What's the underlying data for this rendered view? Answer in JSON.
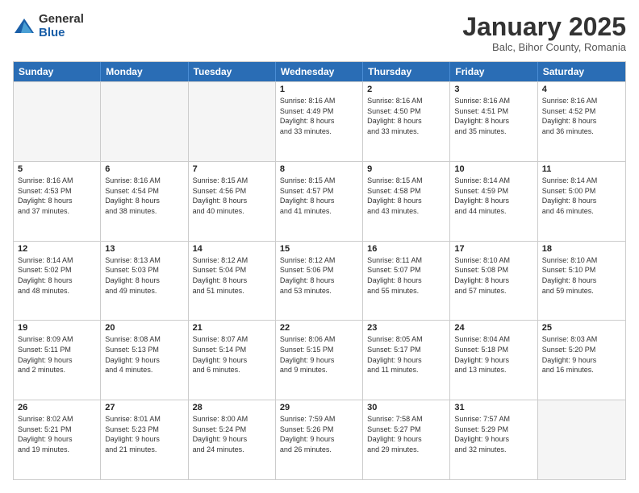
{
  "logo": {
    "general": "General",
    "blue": "Blue"
  },
  "header": {
    "month": "January 2025",
    "location": "Balc, Bihor County, Romania"
  },
  "weekdays": [
    "Sunday",
    "Monday",
    "Tuesday",
    "Wednesday",
    "Thursday",
    "Friday",
    "Saturday"
  ],
  "rows": [
    [
      {
        "day": "",
        "lines": []
      },
      {
        "day": "",
        "lines": []
      },
      {
        "day": "",
        "lines": []
      },
      {
        "day": "1",
        "lines": [
          "Sunrise: 8:16 AM",
          "Sunset: 4:49 PM",
          "Daylight: 8 hours",
          "and 33 minutes."
        ]
      },
      {
        "day": "2",
        "lines": [
          "Sunrise: 8:16 AM",
          "Sunset: 4:50 PM",
          "Daylight: 8 hours",
          "and 33 minutes."
        ]
      },
      {
        "day": "3",
        "lines": [
          "Sunrise: 8:16 AM",
          "Sunset: 4:51 PM",
          "Daylight: 8 hours",
          "and 35 minutes."
        ]
      },
      {
        "day": "4",
        "lines": [
          "Sunrise: 8:16 AM",
          "Sunset: 4:52 PM",
          "Daylight: 8 hours",
          "and 36 minutes."
        ]
      }
    ],
    [
      {
        "day": "5",
        "lines": [
          "Sunrise: 8:16 AM",
          "Sunset: 4:53 PM",
          "Daylight: 8 hours",
          "and 37 minutes."
        ]
      },
      {
        "day": "6",
        "lines": [
          "Sunrise: 8:16 AM",
          "Sunset: 4:54 PM",
          "Daylight: 8 hours",
          "and 38 minutes."
        ]
      },
      {
        "day": "7",
        "lines": [
          "Sunrise: 8:15 AM",
          "Sunset: 4:56 PM",
          "Daylight: 8 hours",
          "and 40 minutes."
        ]
      },
      {
        "day": "8",
        "lines": [
          "Sunrise: 8:15 AM",
          "Sunset: 4:57 PM",
          "Daylight: 8 hours",
          "and 41 minutes."
        ]
      },
      {
        "day": "9",
        "lines": [
          "Sunrise: 8:15 AM",
          "Sunset: 4:58 PM",
          "Daylight: 8 hours",
          "and 43 minutes."
        ]
      },
      {
        "day": "10",
        "lines": [
          "Sunrise: 8:14 AM",
          "Sunset: 4:59 PM",
          "Daylight: 8 hours",
          "and 44 minutes."
        ]
      },
      {
        "day": "11",
        "lines": [
          "Sunrise: 8:14 AM",
          "Sunset: 5:00 PM",
          "Daylight: 8 hours",
          "and 46 minutes."
        ]
      }
    ],
    [
      {
        "day": "12",
        "lines": [
          "Sunrise: 8:14 AM",
          "Sunset: 5:02 PM",
          "Daylight: 8 hours",
          "and 48 minutes."
        ]
      },
      {
        "day": "13",
        "lines": [
          "Sunrise: 8:13 AM",
          "Sunset: 5:03 PM",
          "Daylight: 8 hours",
          "and 49 minutes."
        ]
      },
      {
        "day": "14",
        "lines": [
          "Sunrise: 8:12 AM",
          "Sunset: 5:04 PM",
          "Daylight: 8 hours",
          "and 51 minutes."
        ]
      },
      {
        "day": "15",
        "lines": [
          "Sunrise: 8:12 AM",
          "Sunset: 5:06 PM",
          "Daylight: 8 hours",
          "and 53 minutes."
        ]
      },
      {
        "day": "16",
        "lines": [
          "Sunrise: 8:11 AM",
          "Sunset: 5:07 PM",
          "Daylight: 8 hours",
          "and 55 minutes."
        ]
      },
      {
        "day": "17",
        "lines": [
          "Sunrise: 8:10 AM",
          "Sunset: 5:08 PM",
          "Daylight: 8 hours",
          "and 57 minutes."
        ]
      },
      {
        "day": "18",
        "lines": [
          "Sunrise: 8:10 AM",
          "Sunset: 5:10 PM",
          "Daylight: 8 hours",
          "and 59 minutes."
        ]
      }
    ],
    [
      {
        "day": "19",
        "lines": [
          "Sunrise: 8:09 AM",
          "Sunset: 5:11 PM",
          "Daylight: 9 hours",
          "and 2 minutes."
        ]
      },
      {
        "day": "20",
        "lines": [
          "Sunrise: 8:08 AM",
          "Sunset: 5:13 PM",
          "Daylight: 9 hours",
          "and 4 minutes."
        ]
      },
      {
        "day": "21",
        "lines": [
          "Sunrise: 8:07 AM",
          "Sunset: 5:14 PM",
          "Daylight: 9 hours",
          "and 6 minutes."
        ]
      },
      {
        "day": "22",
        "lines": [
          "Sunrise: 8:06 AM",
          "Sunset: 5:15 PM",
          "Daylight: 9 hours",
          "and 9 minutes."
        ]
      },
      {
        "day": "23",
        "lines": [
          "Sunrise: 8:05 AM",
          "Sunset: 5:17 PM",
          "Daylight: 9 hours",
          "and 11 minutes."
        ]
      },
      {
        "day": "24",
        "lines": [
          "Sunrise: 8:04 AM",
          "Sunset: 5:18 PM",
          "Daylight: 9 hours",
          "and 13 minutes."
        ]
      },
      {
        "day": "25",
        "lines": [
          "Sunrise: 8:03 AM",
          "Sunset: 5:20 PM",
          "Daylight: 9 hours",
          "and 16 minutes."
        ]
      }
    ],
    [
      {
        "day": "26",
        "lines": [
          "Sunrise: 8:02 AM",
          "Sunset: 5:21 PM",
          "Daylight: 9 hours",
          "and 19 minutes."
        ]
      },
      {
        "day": "27",
        "lines": [
          "Sunrise: 8:01 AM",
          "Sunset: 5:23 PM",
          "Daylight: 9 hours",
          "and 21 minutes."
        ]
      },
      {
        "day": "28",
        "lines": [
          "Sunrise: 8:00 AM",
          "Sunset: 5:24 PM",
          "Daylight: 9 hours",
          "and 24 minutes."
        ]
      },
      {
        "day": "29",
        "lines": [
          "Sunrise: 7:59 AM",
          "Sunset: 5:26 PM",
          "Daylight: 9 hours",
          "and 26 minutes."
        ]
      },
      {
        "day": "30",
        "lines": [
          "Sunrise: 7:58 AM",
          "Sunset: 5:27 PM",
          "Daylight: 9 hours",
          "and 29 minutes."
        ]
      },
      {
        "day": "31",
        "lines": [
          "Sunrise: 7:57 AM",
          "Sunset: 5:29 PM",
          "Daylight: 9 hours",
          "and 32 minutes."
        ]
      },
      {
        "day": "",
        "lines": []
      }
    ]
  ]
}
